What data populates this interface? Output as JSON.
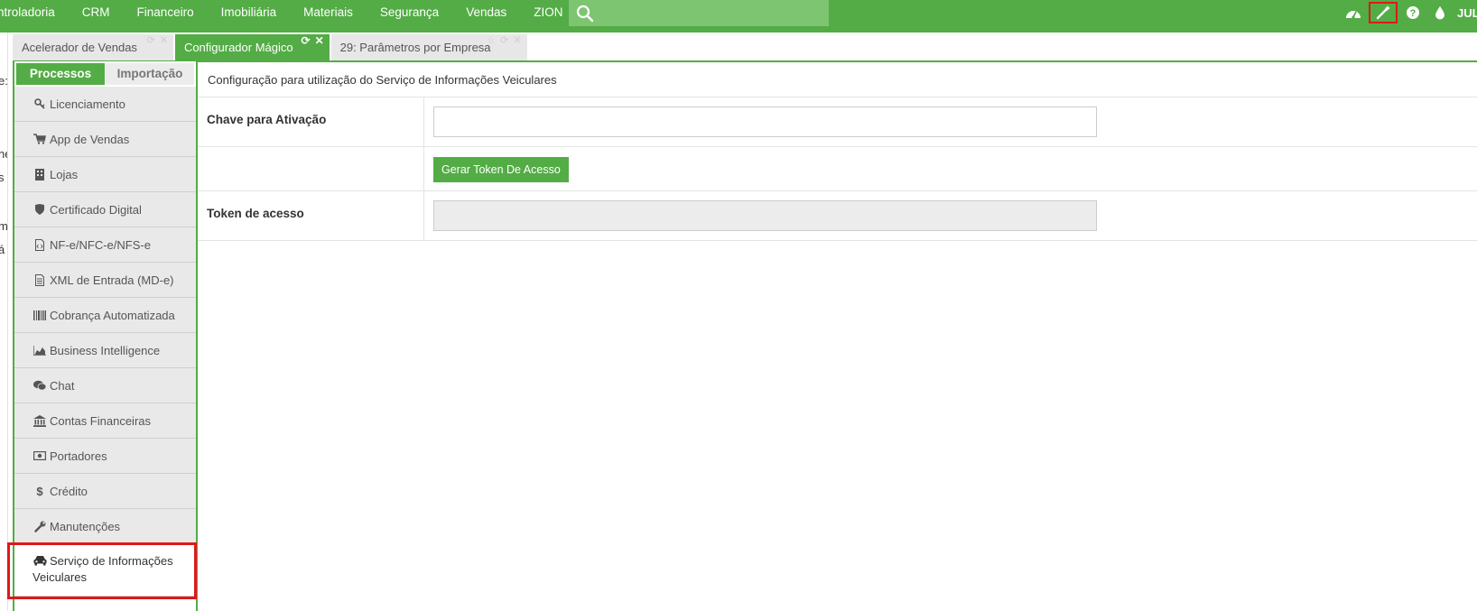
{
  "topnav": {
    "menu": [
      "ntroladoria",
      "CRM",
      "Financeiro",
      "Imobiliária",
      "Materiais",
      "Segurança",
      "Vendas",
      "ZION"
    ],
    "user_label": "JUL",
    "icons": [
      "dashboard-icon",
      "magic-wand-icon",
      "help-icon",
      "drop-icon"
    ]
  },
  "leftcut": [
    "e:",
    "ne",
    "s",
    "m",
    "á"
  ],
  "tabs": [
    {
      "label": "Acelerador de Vendas",
      "active": false
    },
    {
      "label": "Configurador Mágico",
      "active": true
    },
    {
      "label": "29: Parâmetros por Empresa",
      "active": false
    }
  ],
  "sidebar": {
    "tabs": [
      "Processos",
      "Importação"
    ],
    "items": [
      {
        "label": "Licenciamento",
        "icon": "key-icon"
      },
      {
        "label": "App de Vendas",
        "icon": "cart-icon"
      },
      {
        "label": "Lojas",
        "icon": "building-icon"
      },
      {
        "label": "Certificado Digital",
        "icon": "shield-icon"
      },
      {
        "label": "NF-e/NFC-e/NFS-e",
        "icon": "file-code-icon"
      },
      {
        "label": "XML de Entrada (MD-e)",
        "icon": "file-text-icon"
      },
      {
        "label": "Cobrança Automatizada",
        "icon": "barcode-icon"
      },
      {
        "label": "Business Intelligence",
        "icon": "area-chart-icon"
      },
      {
        "label": "Chat",
        "icon": "chat-icon"
      },
      {
        "label": "Contas Financeiras",
        "icon": "bank-icon"
      },
      {
        "label": "Portadores",
        "icon": "money-icon"
      },
      {
        "label": "Crédito",
        "icon": "dollar-icon"
      },
      {
        "label": "Manutenções",
        "icon": "wrench-icon"
      },
      {
        "label": "Serviço de Informações Veiculares",
        "icon": "car-icon"
      }
    ]
  },
  "main": {
    "title": "Configuração para utilização do Serviço de Informações Veiculares",
    "key_label": "Chave para Ativação",
    "key_value": "",
    "button_label": "Gerar Token De Acesso",
    "token_label": "Token de acesso",
    "token_value": ""
  },
  "colors": {
    "brand_green": "#53ac45",
    "search_bg": "#7ec571",
    "highlight_red": "#e01818"
  }
}
